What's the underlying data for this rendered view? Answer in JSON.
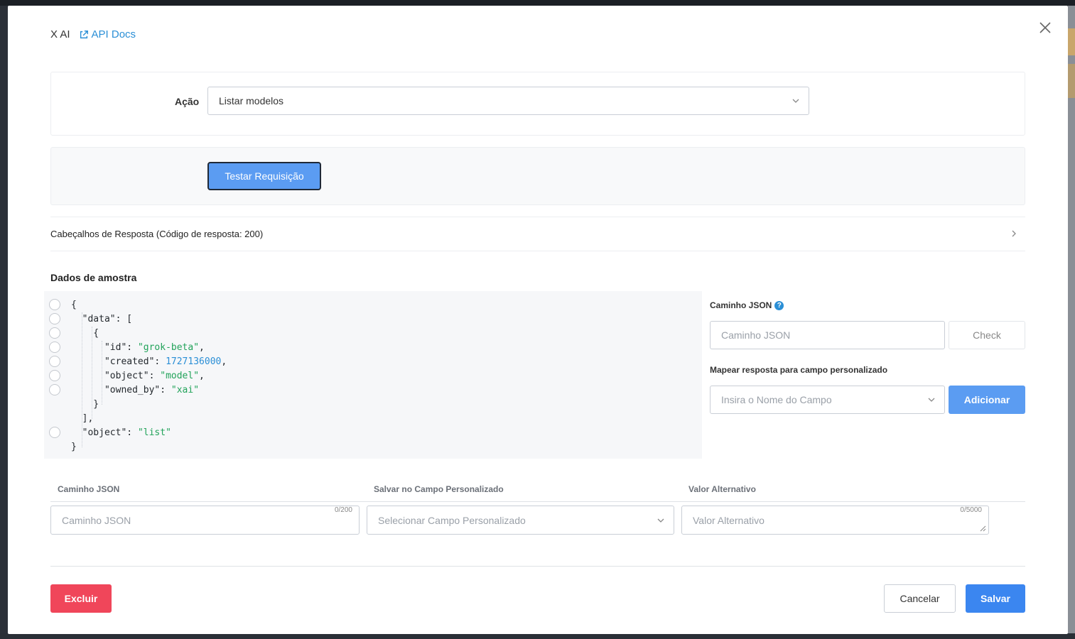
{
  "modal": {
    "title": "X AI",
    "api_docs_label": "API Docs"
  },
  "action": {
    "label": "Ação",
    "selected": "Listar modelos"
  },
  "test_button": "Testar Requisição",
  "response_headers": "Cabeçalhos de Resposta (Código de resposta: 200)",
  "sample": {
    "title": "Dados de amostra"
  },
  "json_path": {
    "label": "Caminho JSON",
    "placeholder": "Caminho JSON",
    "check_label": "Check"
  },
  "map_field": {
    "label": "Mapear resposta para campo personalizado",
    "placeholder": "Insira o Nome do Campo",
    "add_label": "Adicionar"
  },
  "mapping_table": {
    "headers": [
      "Caminho JSON",
      "Salvar no Campo Personalizado",
      "Valor Alternativo"
    ],
    "row": {
      "path_placeholder": "Caminho JSON",
      "path_counter": "0/200",
      "field_placeholder": "Selecionar Campo Personalizado",
      "fallback_placeholder": "Valor Alternativo",
      "fallback_counter": "0/5000"
    }
  },
  "footer": {
    "delete_label": "Excluir",
    "cancel_label": "Cancelar",
    "save_label": "Salvar"
  },
  "colors": {
    "primary": "#3b86f0",
    "primary_light": "#5b9cf2",
    "danger": "#f0465a",
    "link": "#2b8fd6",
    "json_string": "#22a35a",
    "json_number": "#2b8fd6"
  },
  "icons": [
    "external-link-icon",
    "close-icon",
    "chevron-down-icon",
    "chevron-right-icon",
    "help-icon",
    "resize-icon"
  ]
}
